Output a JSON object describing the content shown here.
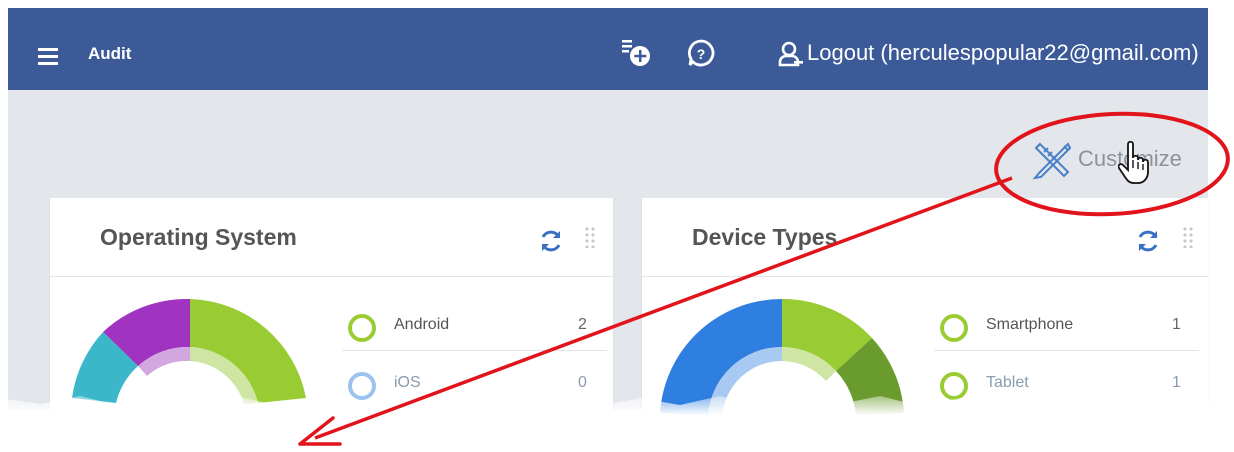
{
  "header": {
    "title": "Audit",
    "user_label": "Logout (herculespopular22@gmail.com)",
    "icons": [
      "menu-icon",
      "add-report-icon",
      "help-icon",
      "user-icon"
    ],
    "bg_color": "#3d5a98"
  },
  "toolbar": {
    "customize_label": "Customize"
  },
  "cards": [
    {
      "title": "Operating System",
      "legend": [
        {
          "label": "Android",
          "count": "2",
          "color": "#99cc33"
        },
        {
          "label": "iOS",
          "count": "0",
          "color": "#9cc2ee"
        }
      ]
    },
    {
      "title": "Device Types",
      "legend": [
        {
          "label": "Smartphone",
          "count": "1",
          "color": "#99cc33"
        },
        {
          "label": "Tablet",
          "count": "1",
          "color": "#99cc33"
        }
      ]
    }
  ],
  "colors": {
    "accent_green": "#99cc33",
    "dark_green": "#6a9b2e",
    "purple": "#a034c0",
    "teal": "#3bb7c9",
    "blue": "#2f7fe0",
    "annotation_red": "#e2141b"
  }
}
